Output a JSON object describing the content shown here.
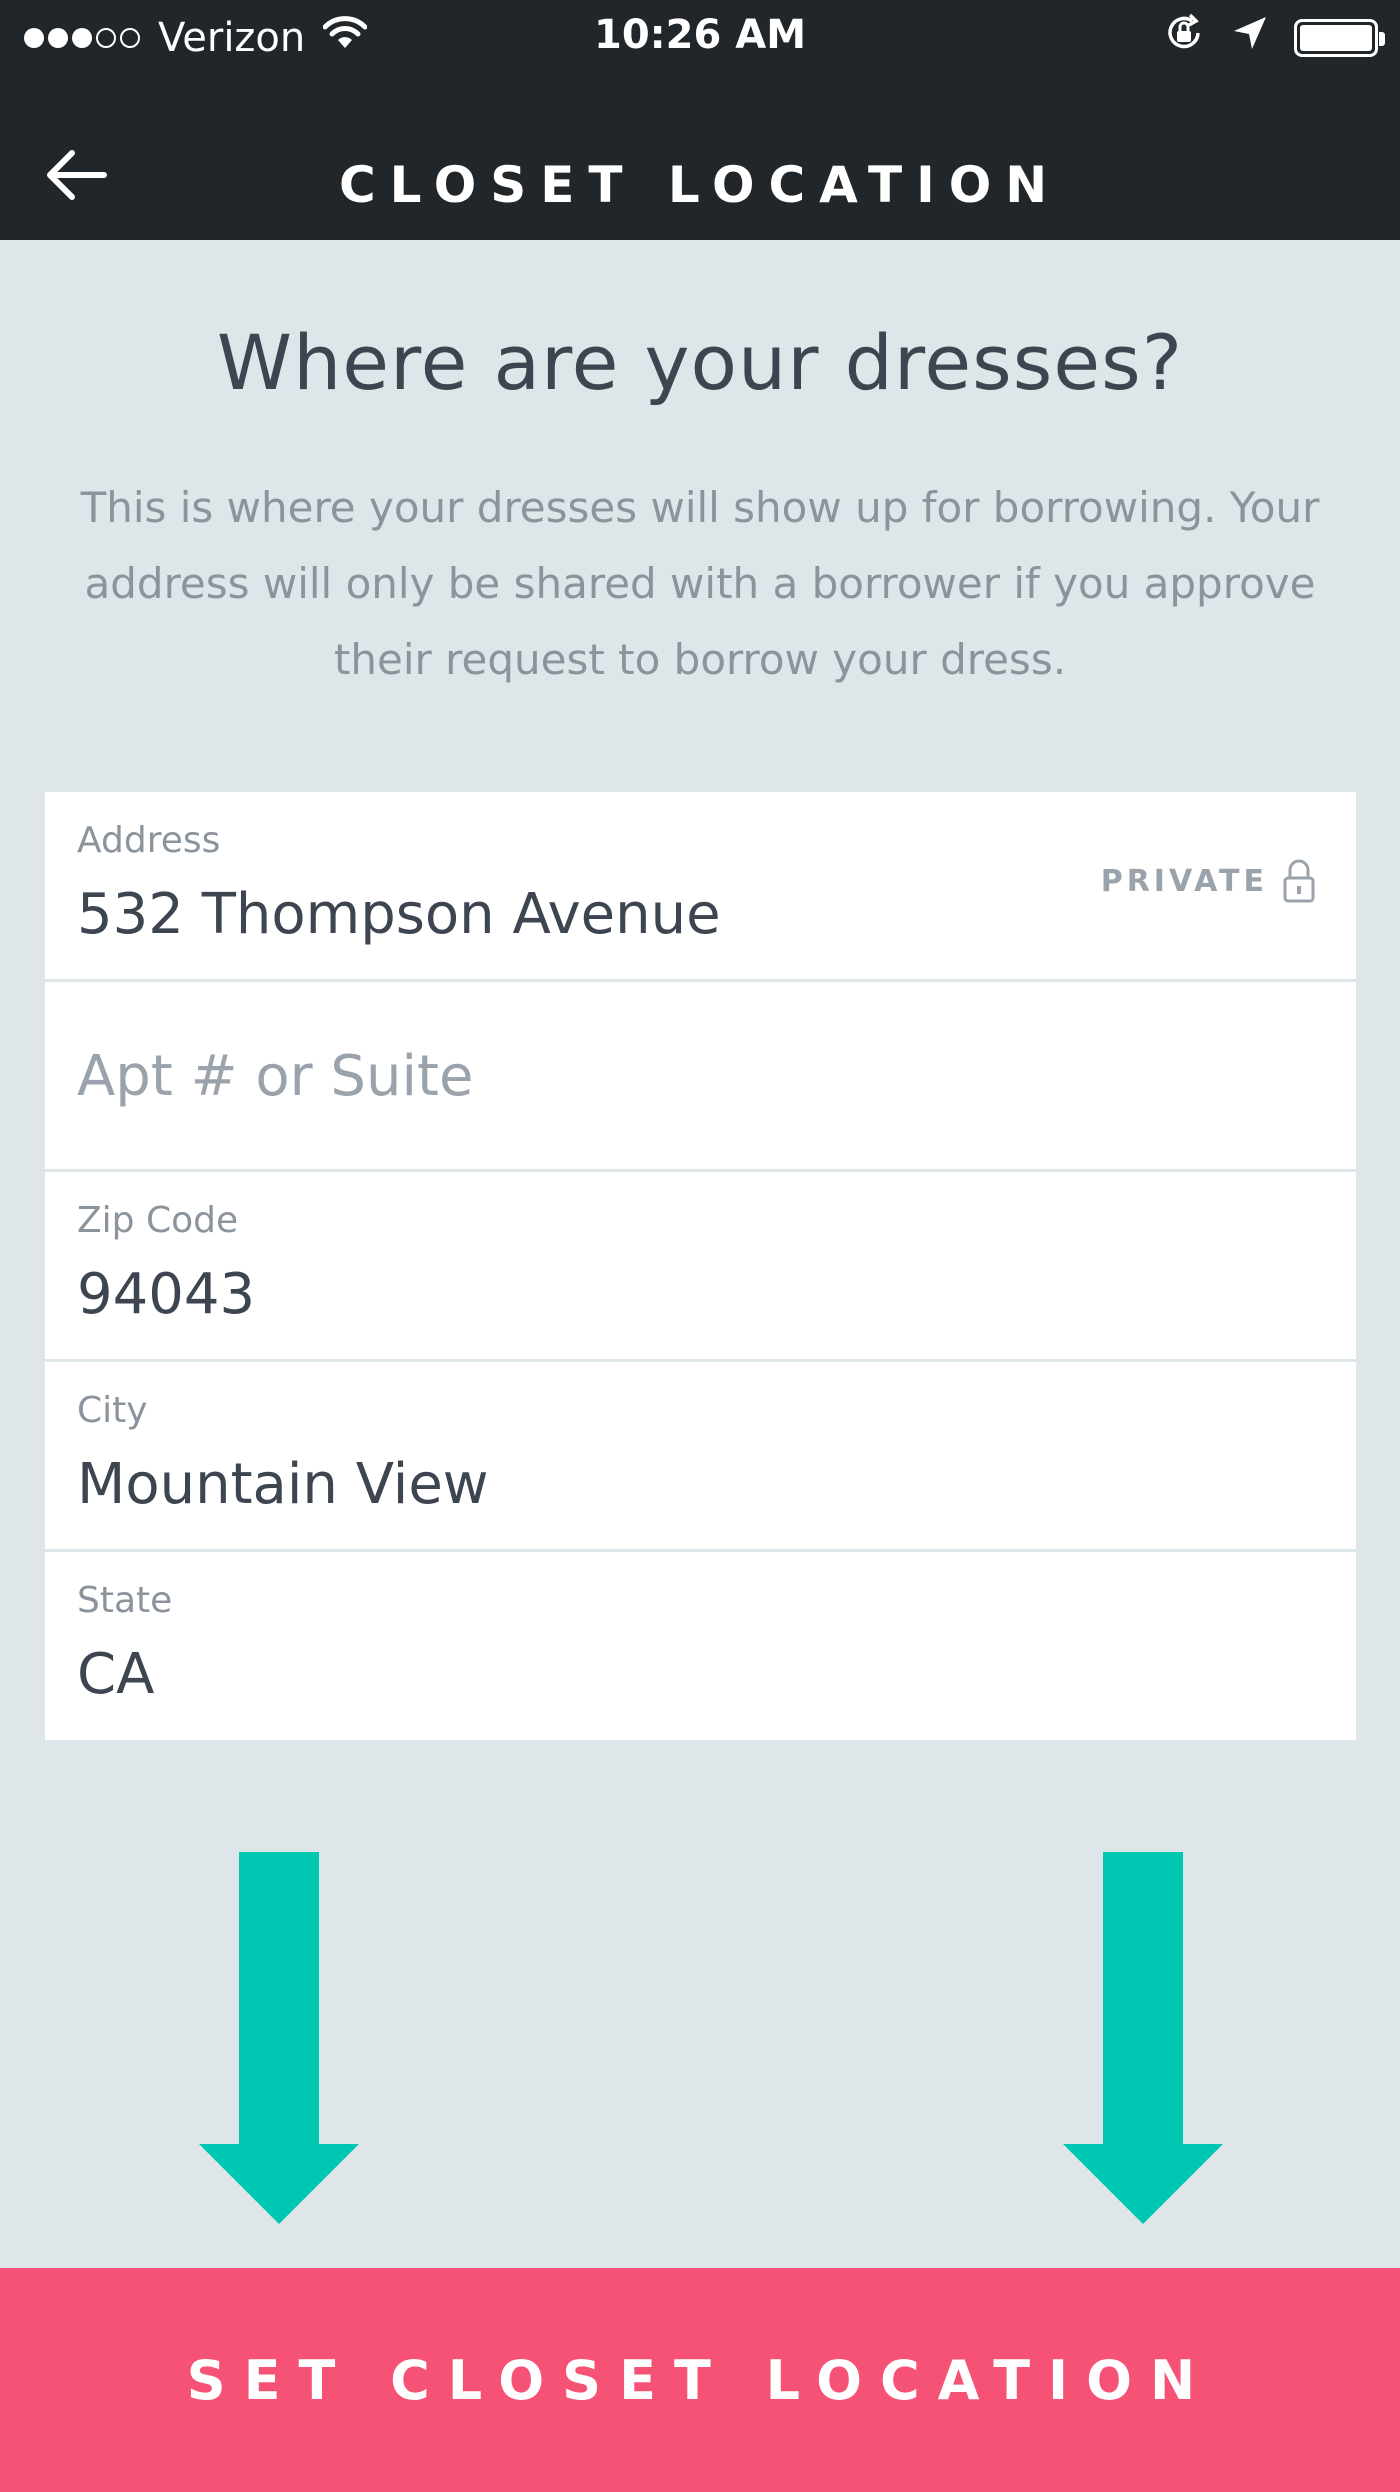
{
  "status_bar": {
    "carrier": "Verizon",
    "time": "10:26 AM",
    "signal_full_dots": 3,
    "signal_empty_dots": 2,
    "icons": [
      "wifi-icon",
      "orientation-lock-icon",
      "location-arrow-icon",
      "battery-icon"
    ]
  },
  "nav": {
    "title": "CLOSET LOCATION",
    "back_icon": "arrow-left-icon"
  },
  "intro": {
    "title": "Where are your dresses?",
    "description": "This is where your dresses will show up for borrowing. Your address will only be shared with a borrower if you approve their request to borrow your dress."
  },
  "form": {
    "address": {
      "label": "Address",
      "value": "532 Thompson Avenue",
      "private_label": "PRIVATE",
      "private_icon": "lock-icon"
    },
    "apt": {
      "placeholder": "Apt # or Suite"
    },
    "zip": {
      "label": "Zip Code",
      "value": "94043"
    },
    "city": {
      "label": "City",
      "value": "Mountain View"
    },
    "state": {
      "label": "State",
      "value": "CA"
    }
  },
  "annotations": {
    "arrow_color": "#00c7b1",
    "arrow_icon": "arrow-down-icon"
  },
  "cta": {
    "label": "SET CLOSET LOCATION",
    "color": "#f65275"
  },
  "theme": {
    "header_bg": "#21262b",
    "page_bg": "#dee6e9",
    "text_dark": "#3d4550",
    "text_muted": "#8b949c"
  }
}
